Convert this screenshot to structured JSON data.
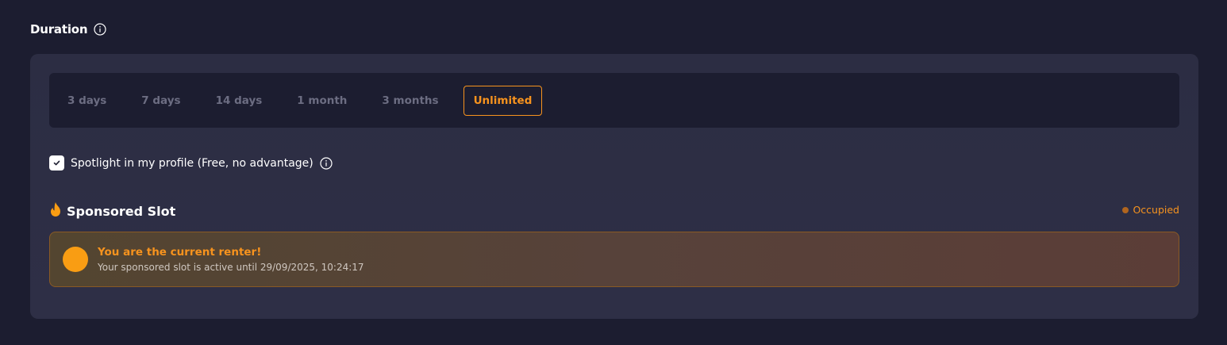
{
  "header": {
    "title": "Duration",
    "icon": "info-icon"
  },
  "tabs": [
    {
      "label": "3 days",
      "active": false
    },
    {
      "label": "7 days",
      "active": false
    },
    {
      "label": "14 days",
      "active": false
    },
    {
      "label": "1 month",
      "active": false
    },
    {
      "label": "3 months",
      "active": false
    },
    {
      "label": "Unlimited",
      "active": true
    }
  ],
  "spotlight": {
    "label": "Spotlight in my profile (Free, no advantage)",
    "checked": true
  },
  "sponsored": {
    "title": "Sponsored Slot",
    "icon": "flame-icon",
    "status": "Occupied",
    "card_title": "You are the current renter!",
    "card_subtitle": "Your sponsored slot is active until 29/09/2025, 10:24:17"
  },
  "colors": {
    "background": "#1c1d30",
    "panel": "#2e2f46",
    "accent": "#f7931e",
    "tab_inactive": "#6c6d82"
  }
}
